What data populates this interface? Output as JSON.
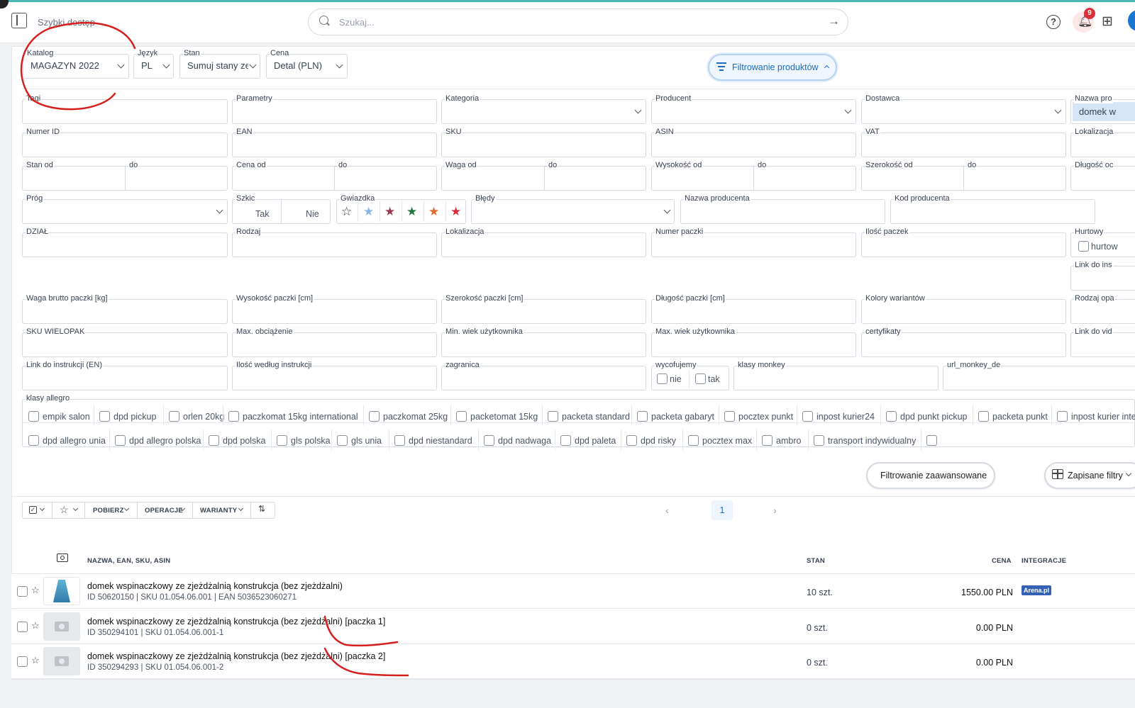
{
  "topbar": {
    "quick_access": "Szybki dostęp",
    "search_placeholder": "Szukaj...",
    "notifications_count": "9"
  },
  "top_filters": {
    "katalog": {
      "label": "Katalog",
      "value": "MAGAZYN 2022"
    },
    "jezyk": {
      "label": "Język",
      "value": "PL"
    },
    "stan": {
      "label": "Stan",
      "value": "Sumuj stany ze w"
    },
    "cena": {
      "label": "Cena",
      "value": "Detal (PLN)"
    },
    "toggle_label": "Filtrowanie produktów"
  },
  "fields": {
    "tagi": "Tagi",
    "parametry": "Parametry",
    "kategoria": "Kategoria",
    "producent": "Producent",
    "dostawca": "Dostawca",
    "nazwa_pro": "Nazwa pro",
    "nazwa_pro_value": "domek w",
    "numer_id": "Numer ID",
    "ean": "EAN",
    "sku": "SKU",
    "asin": "ASIN",
    "vat": "VAT",
    "lokalizacja_short": "Lokalizacja",
    "stan_od": "Stan od",
    "do": "do",
    "cena_od": "Cena od",
    "waga_od": "Waga od",
    "wysokosc_od": "Wysokość od",
    "szerokosc_od": "Szerokość od",
    "dlugosc_od": "Długość oc",
    "prog": "Próg",
    "szkic": "Szkic",
    "szkic_tak": "Tak",
    "szkic_nie": "Nie",
    "gwiazdka": "Gwiazdka",
    "bledy": "Błędy",
    "nazwa_producenta": "Nazwa producenta",
    "kod_producenta": "Kod producenta",
    "dzial": "DZIAŁ",
    "rodzaj": "Rodzaj",
    "lokalizacja": "Lokalizacja",
    "numer_paczki": "Numer paczki",
    "ilosc_paczek": "Ilość paczek",
    "hurtowy": "Hurtowy",
    "hurtow_opt": "hurtow",
    "link_do_ins": "Link do ins",
    "waga_brutto": "Waga brutto paczki [kg]",
    "wysokosc_paczki": "Wysokość paczki [cm]",
    "szerokosc_paczki": "Szerokość paczki [cm]",
    "dlugosc_paczki": "Długość paczki [cm]",
    "kolory": "Kolory wariantów",
    "rodzaj_opa": "Rodzaj opa",
    "sku_wielopak": "SKU WIELOPAK",
    "max_obciazenie": "Max. obciążenie",
    "min_wiek": "Min. wiek użytkownika",
    "max_wiek": "Max. wiek użytkownika",
    "certyfikaty": "certyfikaty",
    "link_do_vid": "Link do vid",
    "link_en": "Link do instrukcji (EN)",
    "ilosc_wg_instr": "Ilość według instrukcji",
    "zagranica": "zagranica",
    "wycofujemy": "wycofujemy",
    "wyc_nie": "nie",
    "wyc_tak": "tak",
    "klasy_monkey": "klasy monkey",
    "url_monkey": "url_monkey_de",
    "klasy_allegro": "klasy allegro"
  },
  "allegro_row1": [
    "empik salon",
    "dpd pickup",
    "orlen 20kg",
    "paczkomat 15kg international",
    "paczkomat 25kg",
    "packetomat 15kg",
    "packeta standard",
    "packeta gabaryt",
    "pocztex punkt",
    "inpost kurier24",
    "dpd punkt pickup",
    "packeta punkt",
    "inpost kurier inter"
  ],
  "allegro_row2": [
    "dpd allegro unia",
    "dpd allegro polska",
    "dpd polska",
    "gls polska",
    "gls unia",
    "dpd niestandard",
    "dpd nadwaga",
    "dpd paleta",
    "dpd risky",
    "pocztex max",
    "ambro",
    "transport indywidualny",
    ""
  ],
  "actions": {
    "advanced": "Filtrowanie zaawansowane",
    "saved": "Zapisane filtry"
  },
  "toolbar": {
    "pobierz": "POBIERZ",
    "operacje": "OPERACJE",
    "warianty": "WARIANTY",
    "page": "1"
  },
  "table": {
    "headers": {
      "name": "NAZWA, EAN, SKU, ASIN",
      "stan": "STAN",
      "cena": "CENA",
      "integracje": "INTEGRACJE"
    },
    "rows": [
      {
        "name": "domek wspinaczkowy ze zjeżdżalnią konstrukcja (bez zjeżdżalni)",
        "meta": "ID 50620150 | SKU 01.054.06.001 | EAN 5036523060271",
        "stan": "10 szt.",
        "cena": "1550.00 PLN",
        "integration": "Arena.pl"
      },
      {
        "name": "domek wspinaczkowy ze zjeżdżalnią konstrukcja (bez zjeżdżalni) [paczka 1]",
        "meta": "ID 350294101 | SKU 01.054.06.001-1",
        "stan": "0 szt.",
        "cena": "0.00 PLN",
        "integration": ""
      },
      {
        "name": "domek wspinaczkowy ze zjeżdżalnią konstrukcja (bez zjeżdżalni) [paczka 2]",
        "meta": "ID 350294293 | SKU 01.054.06.001-2",
        "stan": "0 szt.",
        "cena": "0.00 PLN",
        "integration": ""
      }
    ]
  },
  "colors": {
    "accent": "#1a6bc4",
    "annotation": "#d61f1f",
    "badge": "#d9303b"
  }
}
